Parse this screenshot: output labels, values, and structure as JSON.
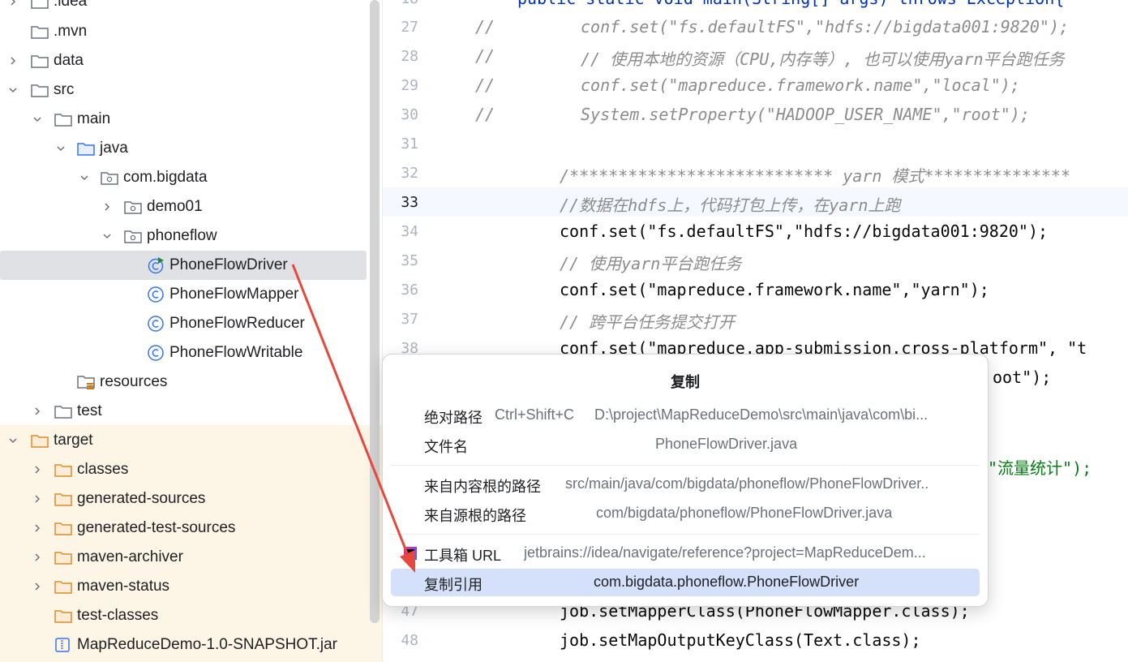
{
  "tree": {
    "items": [
      {
        "label": ".idea",
        "expanded": false,
        "icon": "folder-icon"
      },
      {
        "label": ".mvn",
        "expanded": null,
        "icon": "folder-icon"
      },
      {
        "label": "data",
        "expanded": false,
        "icon": "folder-icon"
      },
      {
        "label": "src",
        "expanded": true,
        "icon": "folder-icon"
      },
      {
        "label": "main",
        "expanded": true,
        "icon": "folder-icon"
      },
      {
        "label": "java",
        "expanded": true,
        "icon": "source-folder-icon"
      },
      {
        "label": "com.bigdata",
        "expanded": true,
        "icon": "package-icon"
      },
      {
        "label": "demo01",
        "expanded": false,
        "icon": "package-icon"
      },
      {
        "label": "phoneflow",
        "expanded": true,
        "icon": "package-icon"
      },
      {
        "label": "PhoneFlowDriver",
        "expanded": null,
        "icon": "runnable-class-icon"
      },
      {
        "label": "PhoneFlowMapper",
        "expanded": null,
        "icon": "class-icon"
      },
      {
        "label": "PhoneFlowReducer",
        "expanded": null,
        "icon": "class-icon"
      },
      {
        "label": "PhoneFlowWritable",
        "expanded": null,
        "icon": "class-icon"
      },
      {
        "label": "resources",
        "expanded": null,
        "icon": "resources-folder-icon"
      },
      {
        "label": "test",
        "expanded": false,
        "icon": "folder-icon"
      },
      {
        "label": "target",
        "expanded": true,
        "icon": "excluded-folder-icon"
      },
      {
        "label": "classes",
        "expanded": false,
        "icon": "excluded-folder-icon"
      },
      {
        "label": "generated-sources",
        "expanded": false,
        "icon": "excluded-folder-icon"
      },
      {
        "label": "generated-test-sources",
        "expanded": false,
        "icon": "excluded-folder-icon"
      },
      {
        "label": "maven-archiver",
        "expanded": false,
        "icon": "excluded-folder-icon"
      },
      {
        "label": "maven-status",
        "expanded": false,
        "icon": "excluded-folder-icon"
      },
      {
        "label": "test-classes",
        "expanded": null,
        "icon": "excluded-folder-icon"
      },
      {
        "label": "MapReduceDemo-1.0-SNAPSHOT.jar",
        "expanded": null,
        "icon": "jar-icon"
      }
    ],
    "selected": "PhoneFlowDriver"
  },
  "editor": {
    "top_partial": "public static void main(String[] args) throws Exception{",
    "lines": [
      {
        "num": "27",
        "text": "conf.set(\"fs.defaultFS\",\"hdfs://bigdata001:9820\");"
      },
      {
        "num": "28",
        "text": "// 使用本地的资源（CPU,内存等）, 也可以使用yarn平台跑任务"
      },
      {
        "num": "29",
        "text": "conf.set(\"mapreduce.framework.name\",\"local\");"
      },
      {
        "num": "30",
        "text": "System.setProperty(\"HADOOP_USER_NAME\",\"root\");"
      },
      {
        "num": "31",
        "text": ""
      },
      {
        "num": "32",
        "text": "/*************************** yarn 模式***************"
      },
      {
        "num": "33",
        "text": "//数据在hdfs上，代码打包上传，在yarn上跑"
      },
      {
        "num": "34",
        "text": "conf.set(\"fs.defaultFS\",\"hdfs://bigdata001:9820\");"
      },
      {
        "num": "35",
        "text": "// 使用yarn平台跑任务"
      },
      {
        "num": "36",
        "text": "conf.set(\"mapreduce.framework.name\",\"yarn\");"
      },
      {
        "num": "37",
        "text": "// 跨平台任务提交打开"
      },
      {
        "num": "38",
        "text": "conf.set(\"mapreduce.app-submission.cross-platform\", \"t"
      },
      {
        "num": "47",
        "text": "job.setMapperClass(PhoneFlowMapper.class);"
      },
      {
        "num": "48",
        "text": "job.setMapOutputKeyClass(Text.class);"
      }
    ],
    "comment_prefix": "//",
    "behind_popup_1": "oot\");",
    "behind_popup_2": "\"流量统计\");",
    "current_line": "33"
  },
  "popup": {
    "title": "复制",
    "rows": [
      {
        "label": "绝对路径",
        "shortcut": "Ctrl+Shift+C",
        "value": "D:\\project\\MapReduceDemo\\src\\main\\java\\com\\bi..."
      },
      {
        "label": "文件名",
        "shortcut": "",
        "value": "PhoneFlowDriver.java"
      },
      {
        "label": "来自内容根的路径",
        "shortcut": "",
        "value": "src/main/java/com/bigdata/phoneflow/PhoneFlowDriver.."
      },
      {
        "label": "来自源根的路径",
        "shortcut": "",
        "value": "com/bigdata/phoneflow/PhoneFlowDriver.java"
      },
      {
        "label": "工具箱 URL",
        "shortcut": "",
        "value": "jetbrains://idea/navigate/reference?project=MapReduceDem..."
      },
      {
        "label": "复制引用",
        "shortcut": "",
        "value": "com.bigdata.phoneflow.PhoneFlowDriver"
      }
    ],
    "highlighted": "复制引用"
  },
  "colors": {
    "accent": "#3574f0",
    "annotation_arrow": "#e8473c",
    "highlight": "#d5e1fb"
  }
}
